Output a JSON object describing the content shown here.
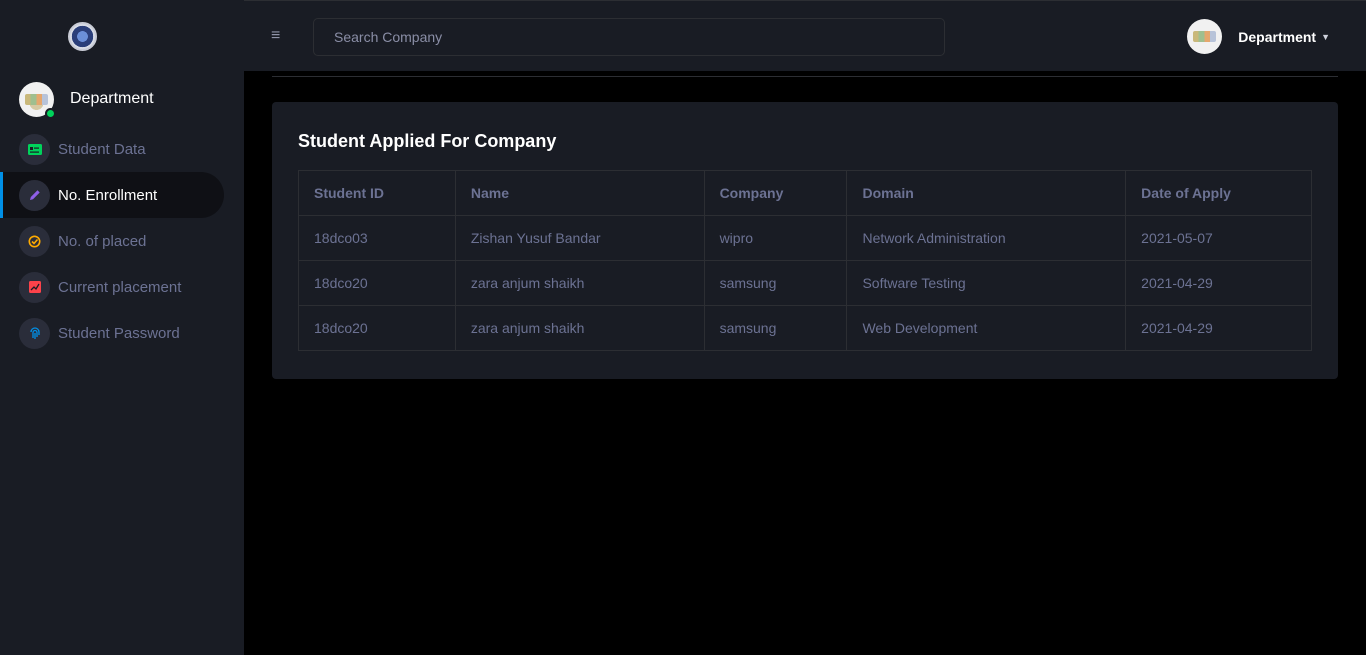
{
  "brand": {
    "logo_icon": "college-logo-icon"
  },
  "sidebar": {
    "profile_name": "Department",
    "items": [
      {
        "label": "Student Data",
        "icon": "id-card-icon",
        "color": "#00d25b",
        "active": false
      },
      {
        "label": "No. Enrollment",
        "icon": "pencil-icon",
        "color": "#8f5fe8",
        "active": true
      },
      {
        "label": "No. of placed",
        "icon": "check-circle-icon",
        "color": "#ffab00",
        "active": false
      },
      {
        "label": "Current placement",
        "icon": "chart-icon",
        "color": "#fc424a",
        "active": false
      },
      {
        "label": "Student Password",
        "icon": "fingerprint-icon",
        "color": "#0090e7",
        "active": false
      }
    ]
  },
  "topbar": {
    "search_placeholder": "Search Company",
    "user_name": "Department"
  },
  "main": {
    "card_title": "Student Applied For Company",
    "columns": [
      "Student ID",
      "Name",
      "Company",
      "Domain",
      "Date of Apply"
    ],
    "rows": [
      [
        "18dco03",
        "Zishan Yusuf Bandar",
        "wipro",
        "Network Administration",
        "2021-05-07"
      ],
      [
        "18dco20",
        "zara anjum shaikh",
        "samsung",
        "Software Testing",
        "2021-04-29"
      ],
      [
        "18dco20",
        "zara anjum shaikh",
        "samsung",
        "Web Development",
        "2021-04-29"
      ]
    ]
  },
  "colors": {
    "sidebar_bg": "#191c24",
    "content_bg": "#000000",
    "active_accent": "#0090e7",
    "online": "#00d25b"
  }
}
